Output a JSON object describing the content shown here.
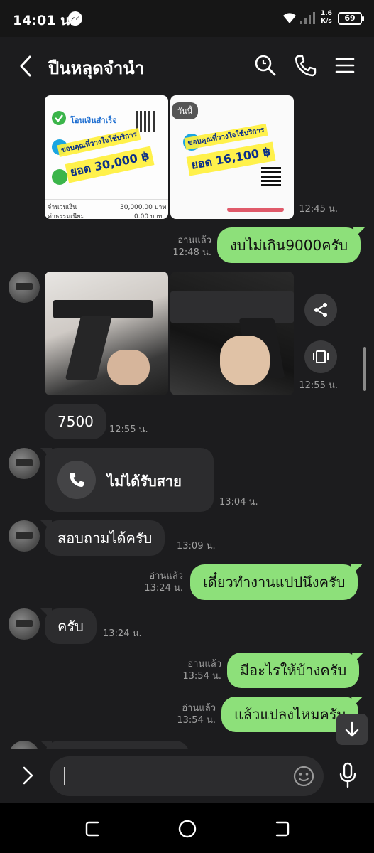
{
  "status_bar": {
    "time": "14:01 น.",
    "speed_value": "1.6",
    "speed_unit": "K/s",
    "battery": "69"
  },
  "header": {
    "title": "ปืนหลุดจำนำ"
  },
  "messages": {
    "receipt_images_time": "12:45 น.",
    "receipt_left": {
      "bank_status": "โอนเงินสำเร็จ",
      "overlay_text": "ยอด 30,000 ฿",
      "overlay_thanks": "ขอบคุณที่วางใจใช้บริการ",
      "amount_label": "จำนวนเงิน",
      "amount_value": "30,000.00 บาท",
      "fee_label": "ค่าธรรมเนียม",
      "fee_value": "0.00 บาท"
    },
    "receipt_right": {
      "tag": "วันนี้",
      "overlay_text": "ยอด 16,100 ฿",
      "overlay_thanks": "ขอบคุณที่วางใจใช้บริการ"
    },
    "out1": {
      "text": "งบไม่เกิน9000ครับ",
      "read": "อ่านแล้ว",
      "time": "12:48 น."
    },
    "gun_images_time": "12:55 น.",
    "in1": {
      "text": "7500",
      "time": "12:55 น."
    },
    "call": {
      "text": "ไม่ได้รับสาย",
      "time": "13:04 น."
    },
    "in2": {
      "text": "สอบถามได้ครับ",
      "time": "13:09 น."
    },
    "out2": {
      "text": "เดี๋ยวทำงานแปปนึงครับ",
      "read": "อ่านแล้ว",
      "time": "13:24 น."
    },
    "in3": {
      "text": "ครับ",
      "time": "13:24 น."
    },
    "out3": {
      "text": "มีอะไรให้บ้างครับ",
      "read": "อ่านแล้ว",
      "time": "13:54 น."
    },
    "out4": {
      "text": "แล้วแปลงไหมครับ",
      "read": "อ่านแล้ว",
      "time": "13:54 น."
    }
  },
  "icons": [
    "back-icon",
    "search-icon",
    "phone-icon",
    "menu-icon",
    "share-icon",
    "gallery-icon",
    "chevron-right-icon",
    "emoji-icon",
    "mic-icon",
    "arrow-down-icon"
  ],
  "colors": {
    "outgoing_bubble": "#8de07a",
    "incoming_bubble": "#2c2c2e",
    "background": "#1c1c1e"
  }
}
